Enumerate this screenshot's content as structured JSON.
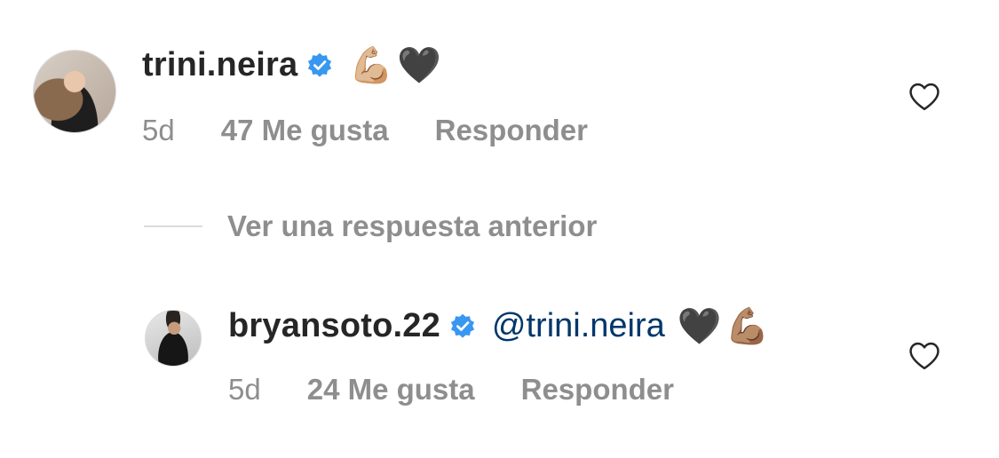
{
  "comments": [
    {
      "username": "trini.neira",
      "verified": true,
      "mention": "",
      "emojis": [
        "💪🏼",
        "🖤"
      ],
      "time": "5d",
      "likes": "47 Me gusta",
      "reply_label": "Responder"
    },
    {
      "username": "bryansoto.22",
      "verified": true,
      "mention": "@trini.neira",
      "emojis": [
        "🖤",
        "💪🏽"
      ],
      "time": "5d",
      "likes": "24 Me gusta",
      "reply_label": "Responder"
    }
  ],
  "view_replies_label": "Ver una respuesta anterior",
  "icons": {
    "verified": "verified-badge-icon",
    "like": "heart-outline-icon"
  },
  "colors": {
    "verified": "#3897f0",
    "mention": "#00376b",
    "meta": "#8e8e8e",
    "text": "#262626"
  }
}
